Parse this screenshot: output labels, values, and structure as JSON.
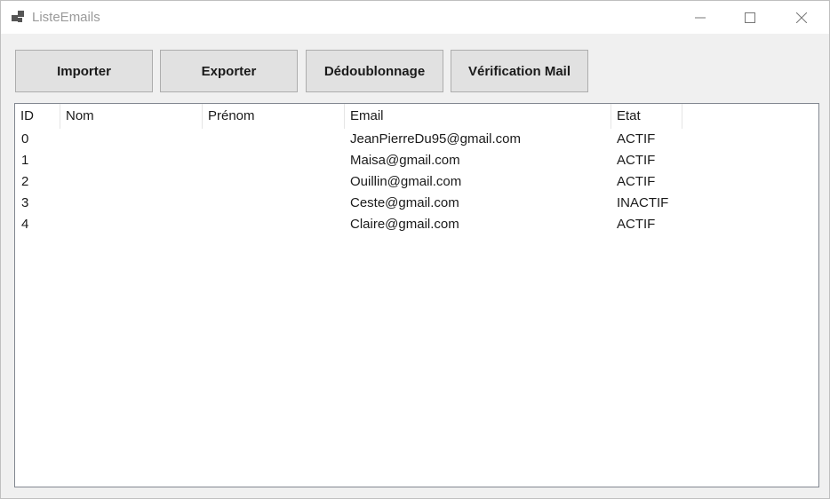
{
  "window": {
    "title": "ListeEmails",
    "icon": "app-window-icon",
    "controls": {
      "minimize": "minimize-icon",
      "maximize": "maximize-icon",
      "close": "close-icon"
    }
  },
  "toolbar": {
    "import_label": "Importer",
    "export_label": "Exporter",
    "dedup_label": "Dédoublonnage",
    "verify_label": "Vérification Mail"
  },
  "list": {
    "columns": [
      "ID",
      "Nom",
      "Prénom",
      "Email",
      "Etat"
    ],
    "rows": [
      {
        "id": "0",
        "nom": "",
        "prenom": "",
        "email": "JeanPierreDu95@gmail.com",
        "etat": "ACTIF"
      },
      {
        "id": "1",
        "nom": "",
        "prenom": "",
        "email": "Maisa@gmail.com",
        "etat": "ACTIF"
      },
      {
        "id": "2",
        "nom": "",
        "prenom": "",
        "email": "Ouillin@gmail.com",
        "etat": "ACTIF"
      },
      {
        "id": "3",
        "nom": "",
        "prenom": "",
        "email": "Ceste@gmail.com",
        "etat": "INACTIF"
      },
      {
        "id": "4",
        "nom": "",
        "prenom": "",
        "email": "Claire@gmail.com",
        "etat": "ACTIF"
      }
    ]
  },
  "colors": {
    "window_bg": "#f0f0f0",
    "titlebar_bg": "#ffffff",
    "button_bg": "#e1e1e1",
    "button_border": "#adadad",
    "list_bg": "#ffffff",
    "list_border": "#828790"
  }
}
